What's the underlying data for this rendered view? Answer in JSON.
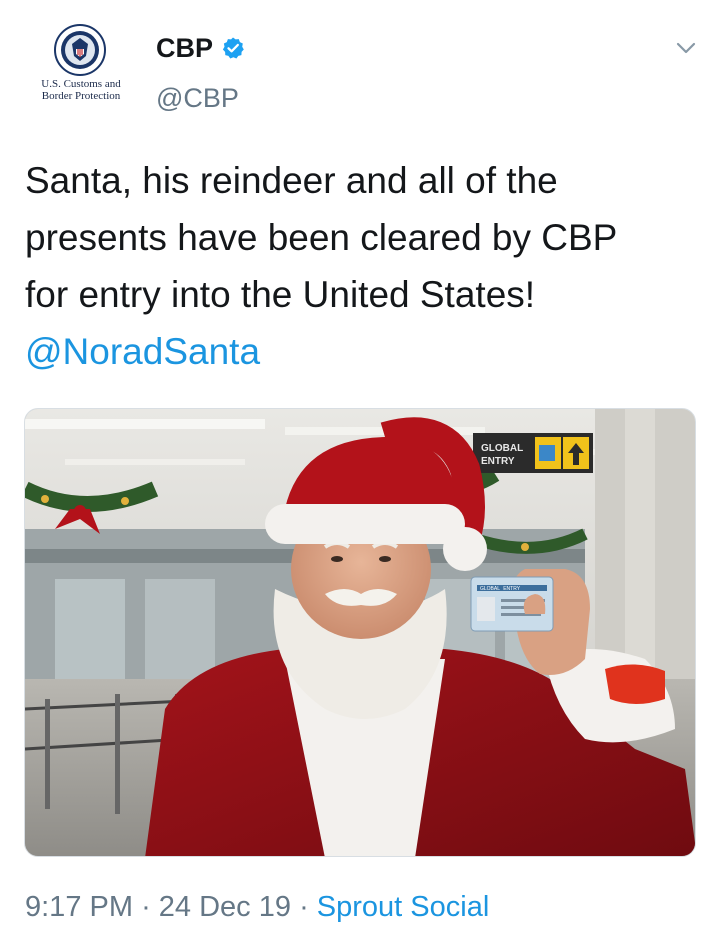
{
  "account": {
    "avatar_caption_line1": "U.S. Customs and",
    "avatar_caption_line2": "Border Protection",
    "display_name": "CBP",
    "handle": "@CBP",
    "verified": true,
    "avatar_icon": "dhs-seal-icon",
    "menu_icon": "chevron-down-icon"
  },
  "tweet": {
    "text": "Santa, his reindeer and all of the presents have been cleared by CBP for entry into the United States! ",
    "mention": "@NoradSanta",
    "photo_card_lines": [
      "GLOBAL",
      "ENTRY"
    ],
    "photo_sign_lines": [
      "GLOBAL",
      "ENTRY"
    ],
    "time": "9:17 PM",
    "separator": "·",
    "date": "24 Dec 19",
    "source": "Sprout Social"
  },
  "colors": {
    "link": "#1b95e0",
    "secondary_text": "#657786",
    "primary_text": "#14171a",
    "verified_badge": "#1da1f2"
  }
}
